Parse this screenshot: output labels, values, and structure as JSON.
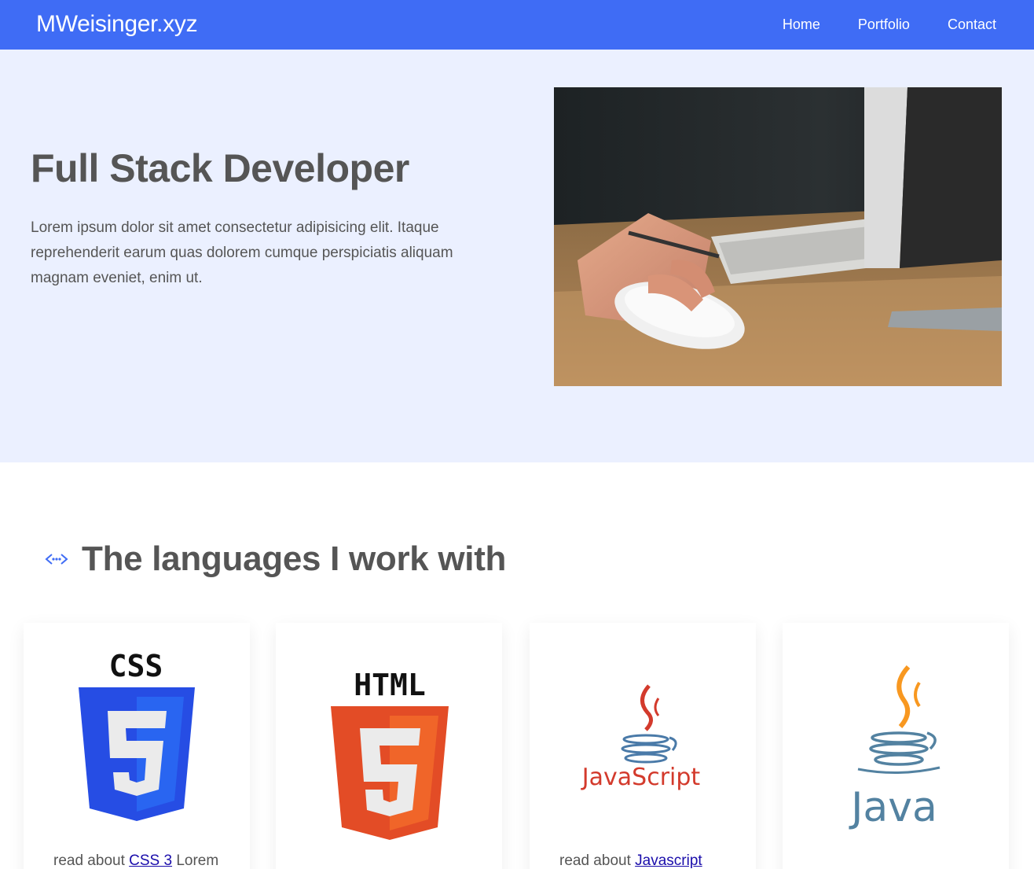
{
  "nav": {
    "brand": "MWeisinger.xyz",
    "links": [
      "Home",
      "Portfolio",
      "Contact"
    ],
    "color": "#3f6cf5"
  },
  "hero": {
    "title": "Full Stack Developer",
    "text": "Lorem ipsum dolor sit amet consectetur adipisicing elit. Itaque reprehenderit earum quas dolorem cumque perspiciatis aliquam magnam eveniet, enim ut.",
    "background": "#ebf0ff"
  },
  "languages": {
    "title": "The languages I work with",
    "icon": "code-arrows-icon",
    "cards": [
      {
        "logo_text": "CSS",
        "prefix": "read about ",
        "link": "CSS 3",
        "suffix": " Lorem"
      },
      {
        "logo_text": "HTML",
        "prefix": "",
        "link": "",
        "suffix": ""
      },
      {
        "logo_text": "JavaScript",
        "prefix": "read about ",
        "link": "Javascript",
        "suffix": ""
      },
      {
        "logo_text": "Java",
        "prefix": "",
        "link": "",
        "suffix": ""
      }
    ]
  }
}
